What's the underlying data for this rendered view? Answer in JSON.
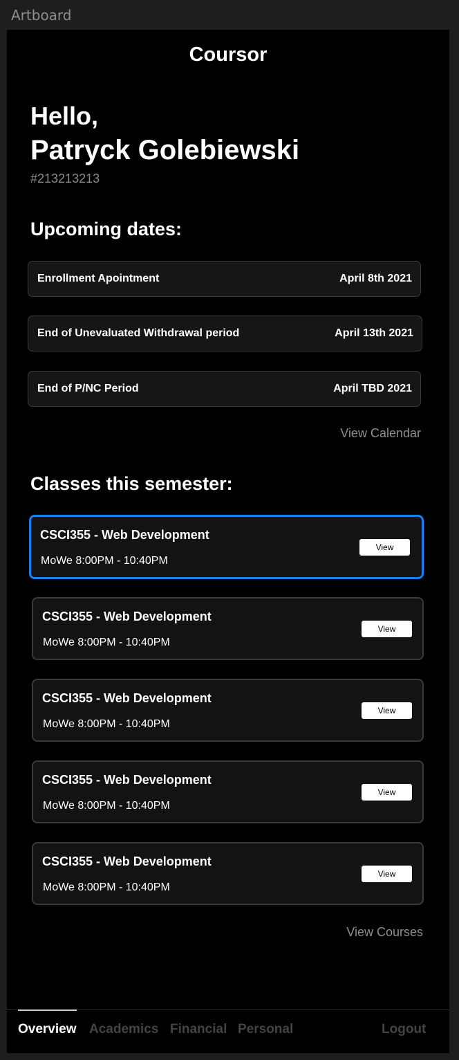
{
  "window": {
    "artboard_label": "Artboard"
  },
  "app": {
    "title": "Coursor"
  },
  "greeting": {
    "hello": "Hello,",
    "name": "Patryck Golebiewski",
    "student_id": "#213213213"
  },
  "upcoming": {
    "title": "Upcoming dates:",
    "items": [
      {
        "label": "Enrollment Apointment",
        "date": "April 8th 2021"
      },
      {
        "label": "End of Unevaluated Withdrawal period",
        "date": "April 13th 2021"
      },
      {
        "label": "End of P/NC Period",
        "date": "April TBD 2021"
      }
    ],
    "view_calendar": "View Calendar"
  },
  "classes": {
    "title": "Classes this semester:",
    "items": [
      {
        "name": "CSCI355 - Web Development",
        "schedule": "MoWe  8:00PM - 10:40PM",
        "button": "View",
        "selected": true
      },
      {
        "name": "CSCI355 - Web Development",
        "schedule": "MoWe  8:00PM - 10:40PM",
        "button": "View",
        "selected": false
      },
      {
        "name": "CSCI355 - Web Development",
        "schedule": "MoWe  8:00PM - 10:40PM",
        "button": "View",
        "selected": false
      },
      {
        "name": "CSCI355 - Web Development",
        "schedule": "MoWe  8:00PM - 10:40PM",
        "button": "View",
        "selected": false
      },
      {
        "name": "CSCI355 - Web Development",
        "schedule": "MoWe  8:00PM - 10:40PM",
        "button": "View",
        "selected": false
      }
    ],
    "view_courses": "View Courses"
  },
  "nav": {
    "items": [
      {
        "label": "Overview",
        "active": true
      },
      {
        "label": "Academics",
        "active": false
      },
      {
        "label": "Financial",
        "active": false
      },
      {
        "label": "Personal",
        "active": false
      }
    ],
    "logout": "Logout"
  },
  "colors": {
    "background": "#000000",
    "card": "#141414",
    "border": "#3a3a3a",
    "accent_selected": "#1a7df0",
    "muted_text": "#8f8f8f",
    "inactive_nav": "#444444"
  }
}
